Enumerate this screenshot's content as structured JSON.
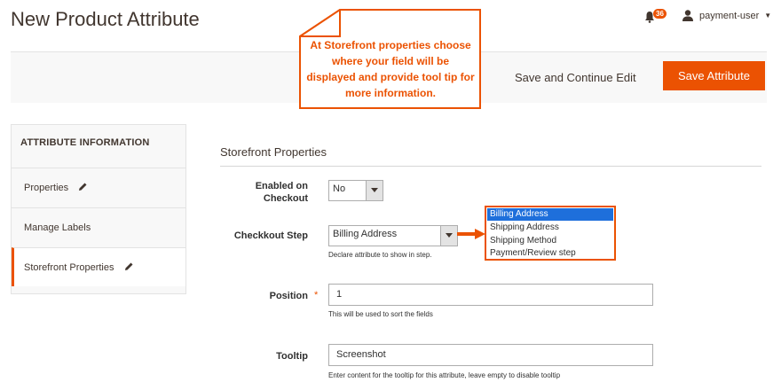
{
  "header": {
    "title": "New Product Attribute",
    "notifications_count": "36",
    "username": "payment-user"
  },
  "actions": {
    "save_continue": "Save and Continue Edit",
    "save_attribute": "Save Attribute"
  },
  "callout": {
    "text": "At Storefront properties choose where your field will be displayed and provide tool tip for more information."
  },
  "sidebar": {
    "heading": "ATTRIBUTE INFORMATION",
    "items": [
      {
        "label": "Properties",
        "icon": "pencil-icon"
      },
      {
        "label": "Manage Labels"
      },
      {
        "label": "Storefront Properties",
        "icon": "pencil-icon",
        "active": true
      }
    ]
  },
  "section": {
    "title": "Storefront Properties"
  },
  "fields": {
    "enabled_checkout": {
      "label_line1": "Enabled on",
      "label_line2": "Checkout",
      "value": "No"
    },
    "checkout_step": {
      "label": "Checkkout Step",
      "value": "Billing Address",
      "note": "Declare attribute to show in step.",
      "options": [
        "Billing Address",
        "Shipping Address",
        "Shipping Method",
        "Payment/Review step"
      ]
    },
    "position": {
      "label": "Position",
      "required_mark": "*",
      "value": "1",
      "note": "This will be used to sort the fields"
    },
    "tooltip": {
      "label": "Tooltip",
      "value": "Screenshot",
      "note": "Enter content for the tooltip for this attribute, leave empty to disable tooltip"
    }
  },
  "colors": {
    "accent": "#eb5202",
    "selected_option": "#1e6fdb"
  }
}
